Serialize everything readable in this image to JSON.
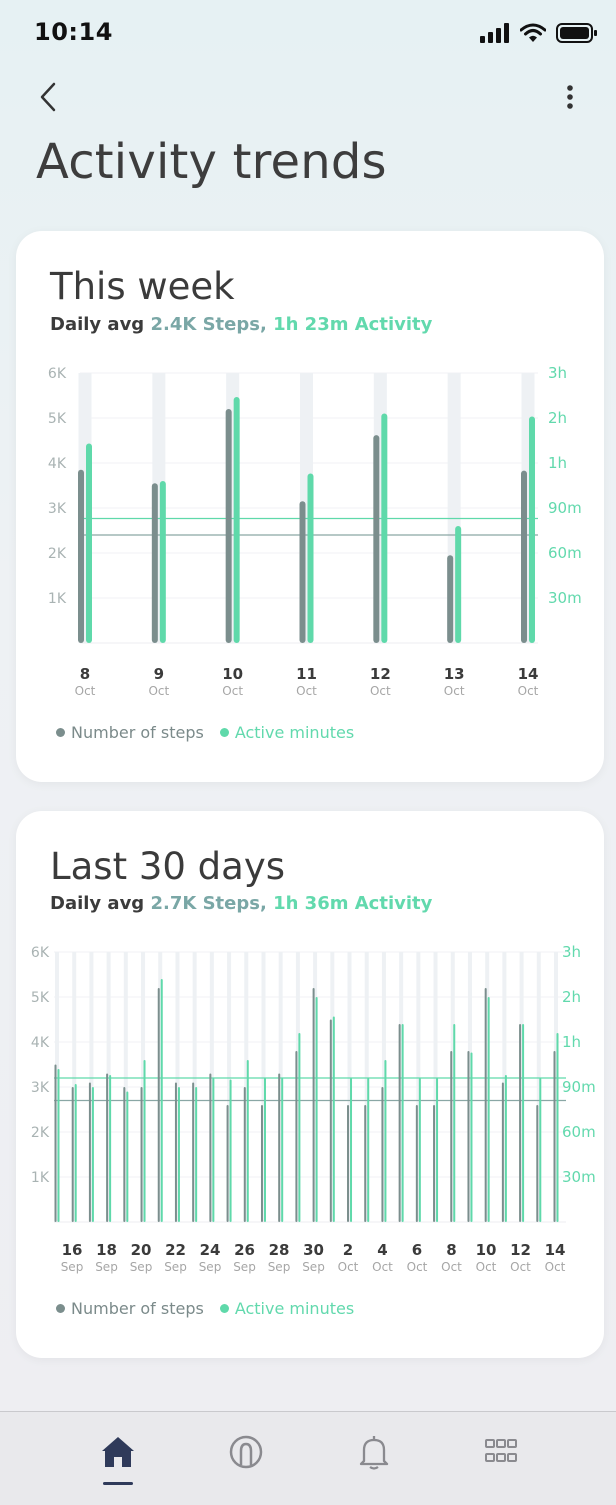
{
  "status_bar": {
    "time": "10:14"
  },
  "header": {
    "title": "Activity trends"
  },
  "colors": {
    "steps": "#7b8e8d",
    "active": "#5fd9aa",
    "track": "#eef1f4"
  },
  "week_card": {
    "title": "This week",
    "sub_prefix": "Daily avg ",
    "sub_steps": "2.4K Steps,",
    "sub_activity": " 1h 23m Activity",
    "legend_steps": "Number of steps",
    "legend_active": "Active minutes"
  },
  "month_card": {
    "title": "Last 30 days",
    "sub_prefix": "Daily avg ",
    "sub_steps": "2.7K Steps,",
    "sub_activity": " 1h 36m Activity",
    "legend_steps": "Number of steps",
    "legend_active": "Active minutes"
  },
  "chart_data": [
    {
      "type": "bar",
      "title": "This week",
      "left_axis_ticks": [
        "6K",
        "5K",
        "4K",
        "3K",
        "2K",
        "1K"
      ],
      "right_axis_ticks": [
        "3h",
        "2h",
        "1h",
        "90m",
        "60m",
        "30m"
      ],
      "ylim_steps": [
        0,
        6000
      ],
      "categories": [
        {
          "day": "8",
          "month": "Oct"
        },
        {
          "day": "9",
          "month": "Oct"
        },
        {
          "day": "10",
          "month": "Oct"
        },
        {
          "day": "11",
          "month": "Oct"
        },
        {
          "day": "12",
          "month": "Oct"
        },
        {
          "day": "13",
          "month": "Oct"
        },
        {
          "day": "14",
          "month": "Oct"
        }
      ],
      "series": [
        {
          "name": "Number of steps",
          "values": [
            3850,
            3550,
            5200,
            3150,
            4620,
            1950,
            3830
          ]
        },
        {
          "name": "Active minutes",
          "values": [
            133,
            108,
            164,
            113,
            153,
            78,
            151
          ]
        }
      ],
      "average_lines": {
        "steps": 2400,
        "active_minutes": 83
      }
    },
    {
      "type": "bar",
      "title": "Last 30 days",
      "left_axis_ticks": [
        "6K",
        "5K",
        "4K",
        "3K",
        "2K",
        "1K"
      ],
      "right_axis_ticks": [
        "3h",
        "2h",
        "1h",
        "90m",
        "60m",
        "30m"
      ],
      "ylim_steps": [
        0,
        6000
      ],
      "tick_labels": [
        {
          "day": "16",
          "month": "Sep"
        },
        {
          "day": "18",
          "month": "Sep"
        },
        {
          "day": "20",
          "month": "Sep"
        },
        {
          "day": "22",
          "month": "Sep"
        },
        {
          "day": "24",
          "month": "Sep"
        },
        {
          "day": "26",
          "month": "Sep"
        },
        {
          "day": "28",
          "month": "Sep"
        },
        {
          "day": "30",
          "month": "Sep"
        },
        {
          "day": "2",
          "month": "Oct"
        },
        {
          "day": "4",
          "month": "Oct"
        },
        {
          "day": "6",
          "month": "Oct"
        },
        {
          "day": "8",
          "month": "Oct"
        },
        {
          "day": "10",
          "month": "Oct"
        },
        {
          "day": "12",
          "month": "Oct"
        },
        {
          "day": "14",
          "month": "Oct"
        }
      ],
      "series": [
        {
          "name": "Number of steps",
          "values": [
            3500,
            3000,
            3100,
            3300,
            3000,
            3000,
            5200,
            3100,
            3100,
            3300,
            2600,
            3000,
            2600,
            3300,
            3800,
            5200,
            4500,
            2600,
            2600,
            3000,
            4400,
            2600,
            2600,
            3800,
            3800,
            5200,
            3100,
            4400,
            2600,
            3800
          ]
        },
        {
          "name": "Active minutes",
          "values": [
            102,
            92,
            90,
            98,
            87,
            108,
            162,
            90,
            90,
            96,
            95,
            108,
            96,
            96,
            126,
            150,
            137,
            96,
            96,
            108,
            132,
            96,
            96,
            132,
            113,
            150,
            98,
            132,
            96,
            126
          ]
        }
      ],
      "average_lines": {
        "steps": 2700,
        "active_minutes": 96
      }
    }
  ]
}
